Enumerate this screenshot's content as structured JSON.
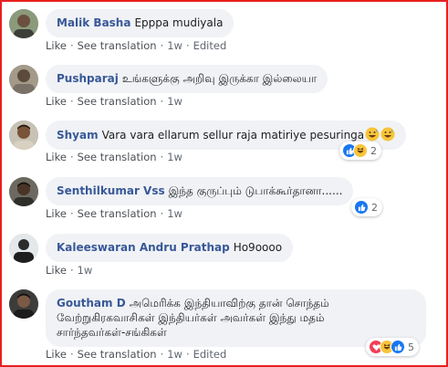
{
  "comments": [
    {
      "author": "Malik Basha",
      "text": "Epppa mudiyala",
      "like_label": "Like",
      "translation_label": "See translation",
      "time": "1w",
      "edited_label": "Edited"
    },
    {
      "author": "Pushparaj",
      "text": "உங்களுக்கு அறிவு இருக்கா இல்லையா",
      "like_label": "Like",
      "translation_label": "See translation",
      "time": "1w"
    },
    {
      "author": "Shyam",
      "text": "Vara vara ellarum sellur raja matiriye pesuringa",
      "like_label": "Like",
      "translation_label": "See translation",
      "time": "1w",
      "reactions": [
        "like",
        "haha"
      ],
      "reaction_count": "2",
      "emoji": [
        "grinning-sweat-emoji",
        "grinning-sweat-emoji"
      ]
    },
    {
      "author": "Senthilkumar Vss",
      "text": "இந்த குருப்பும் டுபாக்கூர்தானா......",
      "like_label": "Like",
      "translation_label": "See translation",
      "time": "1w",
      "reactions": [
        "like"
      ],
      "reaction_count": "2"
    },
    {
      "author": "Kaleeswaran Andru Prathap",
      "text": "Ho9oooo",
      "like_label": "Like",
      "time": "1w"
    },
    {
      "author": "Goutham D",
      "text_line1": "அமெரிக்க இந்தியாவிற்கு தான் சொந்தம்",
      "text_line2": "வேற்றுகிரகவாசிகள் இந்தியர்கள் அவர்கள் இந்து மதம்",
      "text_line3": "சார்ந்தவர்கள்-சங்கிகள்",
      "like_label": "Like",
      "translation_label": "See translation",
      "time": "1w",
      "edited_label": "Edited",
      "reactions": [
        "love",
        "haha",
        "like"
      ],
      "reaction_count": "5"
    }
  ],
  "colors": {
    "author": "#385898",
    "bubble": "#f0f2f5",
    "border": "#e8201e",
    "like_reaction": "#1877f2",
    "love_reaction": "#f33e58",
    "haha_reaction": "#f7c53a"
  }
}
